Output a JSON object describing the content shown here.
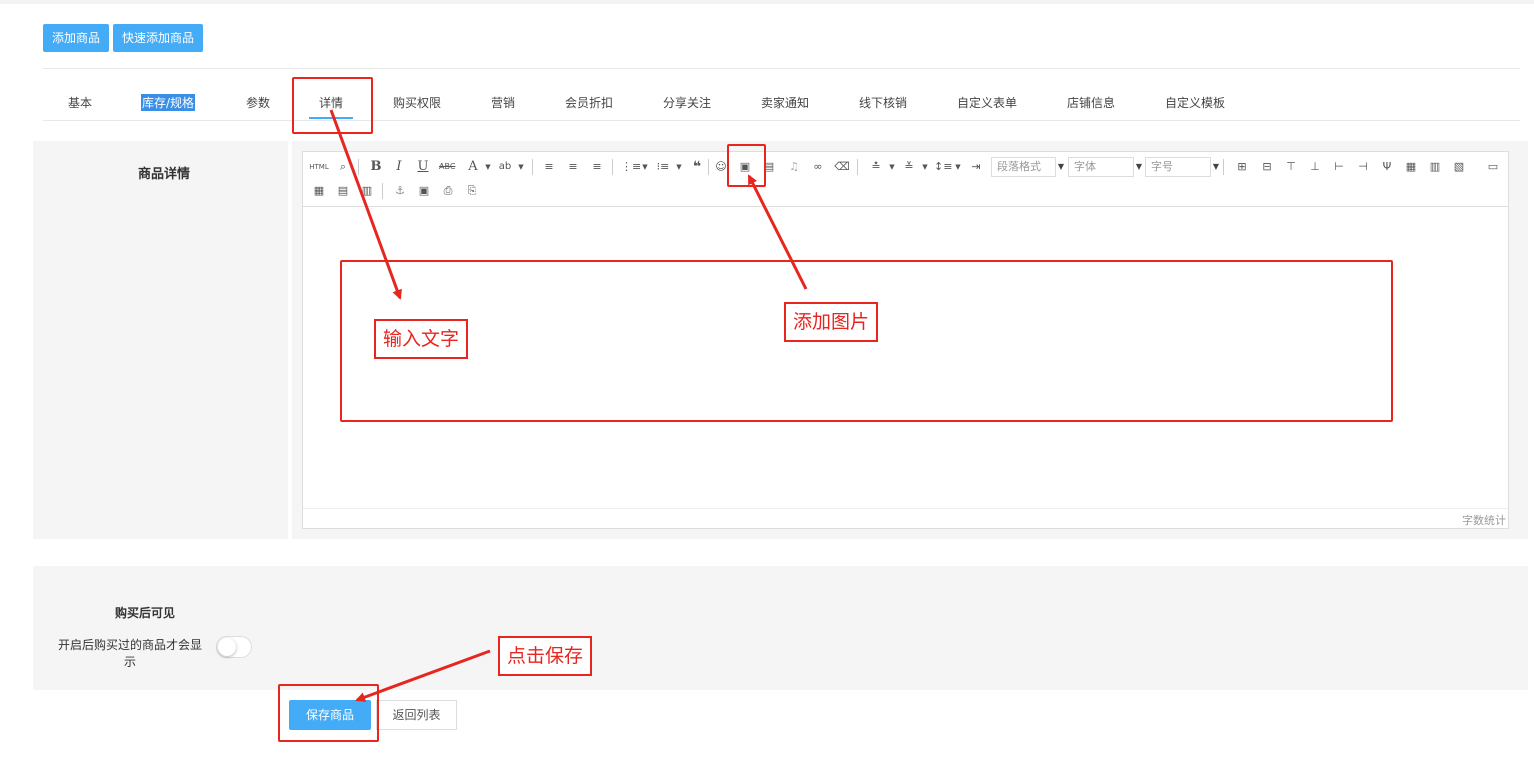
{
  "header": {
    "add_product_label": "添加商品",
    "quick_add_label": "快速添加商品"
  },
  "tabs": [
    {
      "label": "基本"
    },
    {
      "label": "库存/规格"
    },
    {
      "label": "参数"
    },
    {
      "label": "详情"
    },
    {
      "label": "购买权限"
    },
    {
      "label": "营销"
    },
    {
      "label": "会员折扣"
    },
    {
      "label": "分享关注"
    },
    {
      "label": "卖家通知"
    },
    {
      "label": "线下核销"
    },
    {
      "label": "自定义表单"
    },
    {
      "label": "店铺信息"
    },
    {
      "label": "自定义模板"
    }
  ],
  "detail": {
    "label": "商品详情",
    "toolbar": {
      "paragraph_placeholder": "段落格式",
      "font_placeholder": "字体",
      "size_placeholder": "字号",
      "html_label": "HTML"
    },
    "word_count_label": "字数统计"
  },
  "visibility": {
    "title": "购买后可见",
    "description": "开启后购买过的商品才会显示",
    "enabled": false
  },
  "actions": {
    "save_label": "保存商品",
    "back_label": "返回列表"
  },
  "annotations": {
    "input_text": "输入文字",
    "add_image": "添加图片",
    "click_save": "点击保存"
  },
  "colors": {
    "accent": "#44abf7",
    "annotation_red": "#e6261f"
  }
}
